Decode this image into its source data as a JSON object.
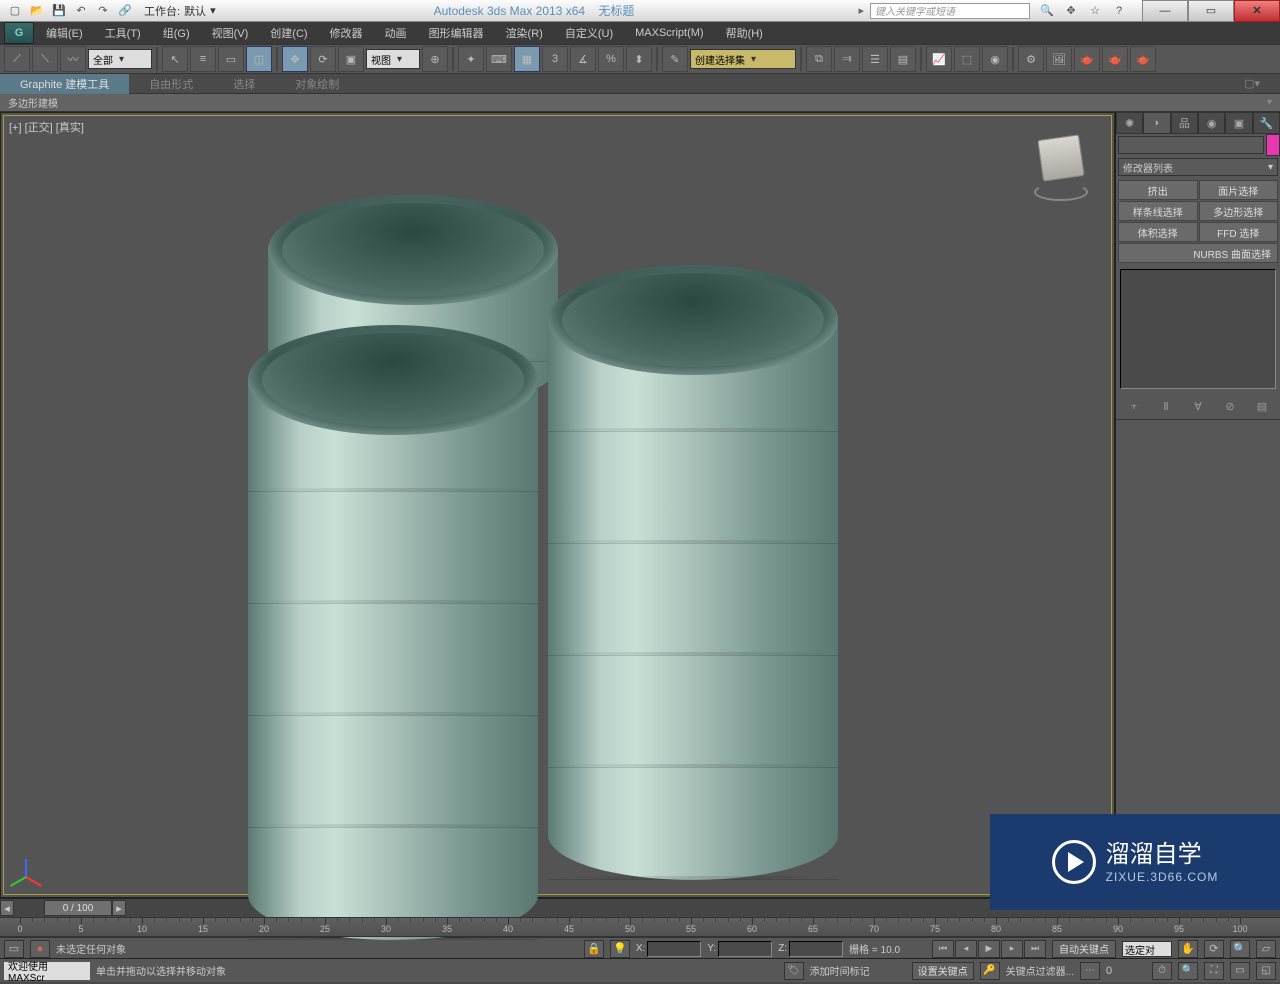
{
  "title": {
    "app": "Autodesk 3ds Max  2013 x64",
    "doc": "无标题",
    "workspace_label": "工作台:",
    "workspace_value": "默认",
    "search_placeholder": "键入关键字或短语"
  },
  "menu": [
    "编辑(E)",
    "工具(T)",
    "组(G)",
    "视图(V)",
    "创建(C)",
    "修改器",
    "动画",
    "图形编辑器",
    "渲染(R)",
    "自定义(U)",
    "MAXScript(M)",
    "帮助(H)"
  ],
  "toolbar": {
    "sel_filter": "全部",
    "ref_sys": "视图",
    "named_sel": "创建选择集"
  },
  "ribbon": {
    "tabs": [
      "Graphite 建模工具",
      "自由形式",
      "选择",
      "对象绘制"
    ],
    "sub": "多边形建模"
  },
  "viewport": {
    "label": "[+] [正交] [真实]"
  },
  "cmd": {
    "modlist": "修改器列表",
    "btns": [
      "挤出",
      "面片选择",
      "样条线选择",
      "多边形选择",
      "体积选择",
      "FFD 选择"
    ],
    "nurbs": "NURBS 曲面选择"
  },
  "timeline": {
    "slider": "0 / 100",
    "ticks": [
      0,
      5,
      10,
      15,
      20,
      25,
      30,
      35,
      40,
      45,
      50,
      55,
      60,
      65,
      70,
      75,
      80,
      85,
      90,
      95,
      100
    ]
  },
  "status": {
    "prompt_top": "未选定任何对象",
    "prompt_bottom": "单击并拖动以选择并移动对象",
    "welcome": "欢迎使用  MAXScr",
    "x": "X:",
    "y": "Y:",
    "z": "Z:",
    "grid": "栅格 = 10.0",
    "add_time": "添加时间标记",
    "auto_key": "自动关键点",
    "set_key": "设置关键点",
    "sel": "选定对",
    "key_filter": "关键点过滤器..."
  },
  "watermark": {
    "main": "溜溜自学",
    "sub": "ZIXUE.3D66.COM"
  }
}
